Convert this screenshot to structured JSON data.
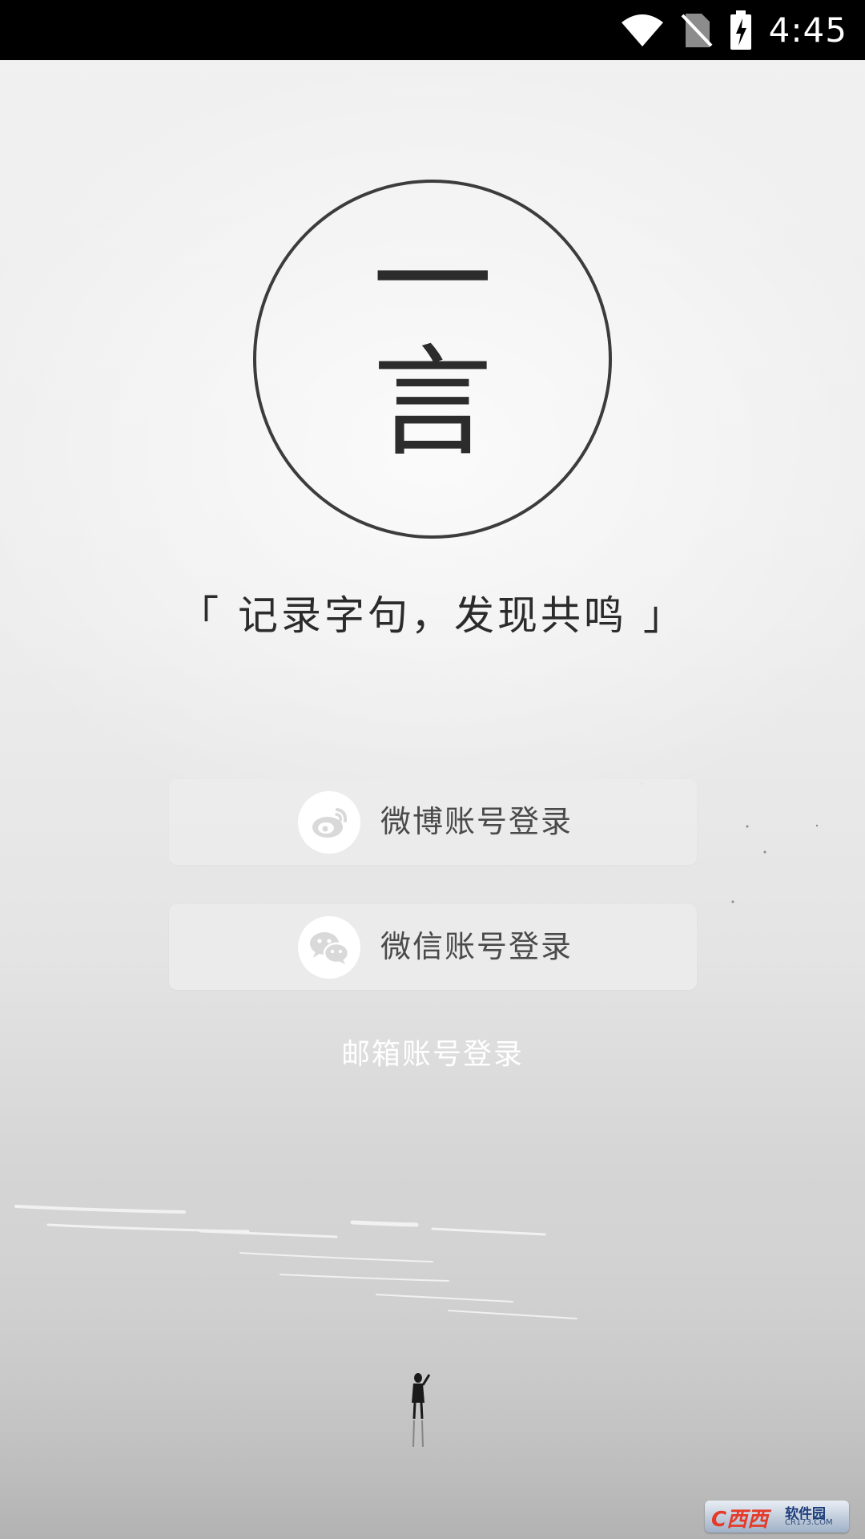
{
  "status_bar": {
    "time": "4:45",
    "icons": [
      "wifi-icon",
      "no-sim-icon",
      "battery-charging-icon"
    ]
  },
  "logo": {
    "char_top": "一",
    "char_bottom": "言"
  },
  "slogan": "「 记录字句，发现共鸣 」",
  "login": {
    "weibo_label": "微博账号登录",
    "wechat_label": "微信账号登录",
    "email_label": "邮箱账号登录"
  },
  "watermark": {
    "brand": "C西西",
    "text": "软件园",
    "sub": "CR173.COM"
  },
  "colors": {
    "status_bar": "#000000",
    "logo_stroke": "#3c3c3c",
    "button_bg": "#ececec",
    "button_text": "#4a4a4a",
    "email_text": "#ffffff"
  }
}
